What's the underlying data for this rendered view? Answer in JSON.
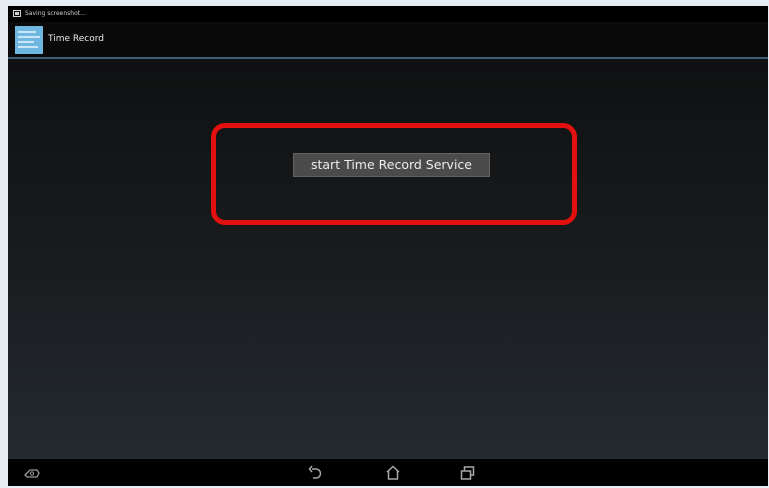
{
  "status_bar": {
    "notification_icon": "screenshot-icon",
    "notification_text": "Saving screenshot..."
  },
  "action_bar": {
    "app_icon": "app-launcher-icon",
    "title": "Time Record"
  },
  "main": {
    "start_button_label": "start Time Record Service",
    "highlight_color": "#e31010"
  },
  "nav_bar": {
    "icons": [
      "screenshot-icon",
      "back-icon",
      "home-icon",
      "recent-apps-icon"
    ]
  }
}
